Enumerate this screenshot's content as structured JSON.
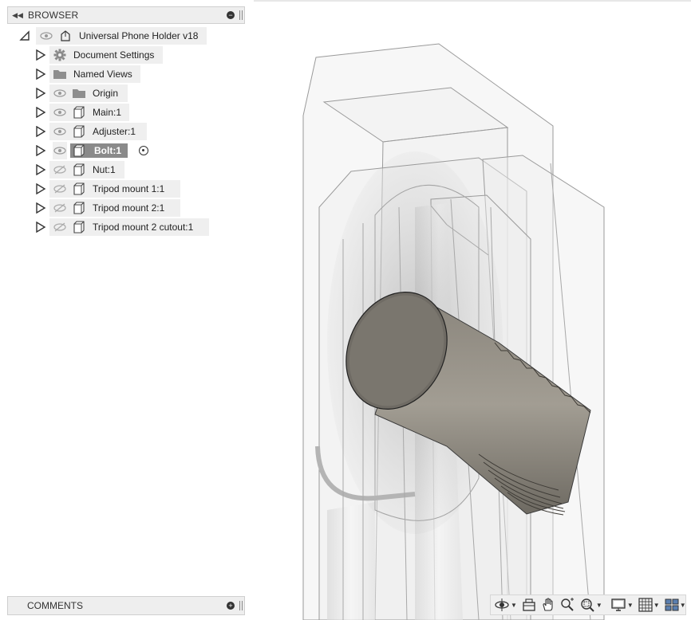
{
  "browser": {
    "title": "BROWSER",
    "root": "Universal Phone Holder v18",
    "items": [
      {
        "label": "Document Settings",
        "icon": "gear-icon",
        "visible": null
      },
      {
        "label": "Named Views",
        "icon": "folder-icon",
        "visible": null
      },
      {
        "label": "Origin",
        "icon": "folder-icon",
        "visible": true
      },
      {
        "label": "Main:1",
        "icon": "component-icon",
        "visible": true
      },
      {
        "label": "Adjuster:1",
        "icon": "component-icon",
        "visible": true
      },
      {
        "label": "Bolt:1",
        "icon": "component-icon",
        "visible": true,
        "selected": true
      },
      {
        "label": "Nut:1",
        "icon": "component-icon",
        "visible": false
      },
      {
        "label": "Tripod mount 1:1",
        "icon": "component-icon",
        "visible": false
      },
      {
        "label": "Tripod mount 2:1",
        "icon": "component-icon",
        "visible": false
      },
      {
        "label": "Tripod mount 2 cutout:1",
        "icon": "component-icon",
        "visible": false
      }
    ]
  },
  "comments": {
    "title": "COMMENTS"
  },
  "navbar": {
    "tools": [
      "orbit-icon",
      "look-at-icon",
      "pan-icon",
      "zoom-icon",
      "zoom-window-icon",
      "display-settings-icon",
      "grid-settings-icon",
      "viewports-icon"
    ]
  },
  "colors": {
    "selection": "#8a8a8a",
    "panel": "#efefef",
    "bolt": "#6e6a62"
  }
}
